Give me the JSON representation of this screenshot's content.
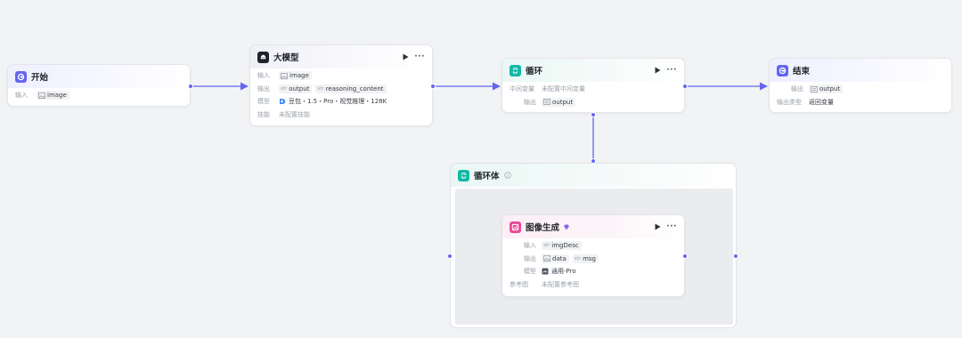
{
  "colors": {
    "canvas": "#f2f3f5",
    "edge": "#6366f1",
    "start_icon": "#6366f1",
    "llm_icon": "#1f2329",
    "loop_icon": "#14b8a6",
    "end_icon": "#6366f1",
    "image_icon": "#ec4899"
  },
  "nodes": {
    "start": {
      "title": "开始",
      "icon": "start-icon",
      "input_label": "输入",
      "input_value": "image"
    },
    "llm": {
      "title": "大模型",
      "icon": "llm-icon",
      "input_label": "输入",
      "input_value": "image",
      "output_label": "输出",
      "outputs": [
        {
          "type": "str",
          "name": "output"
        },
        {
          "type": "str",
          "name": "reasoning_content"
        }
      ],
      "model_label": "模型",
      "model_value": "豆包・1.5・Pro・视觉推理・128K",
      "skill_label": "技能",
      "skill_value": "未配置技能"
    },
    "loop": {
      "title": "循环",
      "icon": "loop-icon",
      "intermediate_label": "中间变量",
      "intermediate_value": "未配置中间变量",
      "output_label": "输出",
      "output_value": "output"
    },
    "end": {
      "title": "结束",
      "icon": "end-icon",
      "output_label": "输出",
      "output_value": "output",
      "output_type_label": "输出类型",
      "output_type_value": "返回变量"
    },
    "loop_body": {
      "title": "循环体",
      "icon": "loop-icon"
    },
    "image_gen": {
      "title": "图像生成",
      "icon": "image-gen-icon",
      "input_label": "输入",
      "inputs": [
        {
          "type": "str",
          "name": "imgDesc"
        }
      ],
      "output_label": "输出",
      "outputs": [
        {
          "type": "img",
          "name": "data"
        },
        {
          "type": "str",
          "name": "msg"
        }
      ],
      "model_label": "模型",
      "model_value": "通用-Pro",
      "ref_label": "参考图",
      "ref_value": "未配置参考图"
    }
  }
}
